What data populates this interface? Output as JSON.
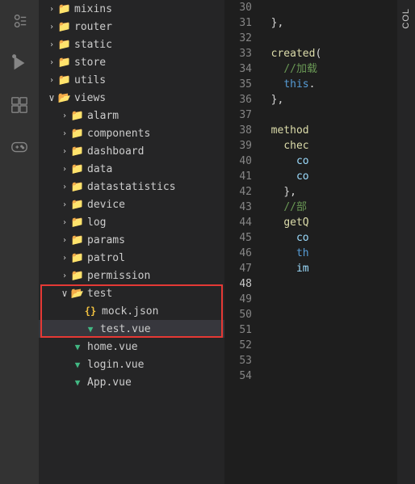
{
  "activityBar": {
    "icons": [
      {
        "name": "explorer-icon",
        "label": "Explorer"
      },
      {
        "name": "run-icon",
        "label": "Run"
      },
      {
        "name": "extensions-icon",
        "label": "Extensions"
      },
      {
        "name": "gamepad-icon",
        "label": "Gamepad"
      }
    ]
  },
  "fileTree": {
    "items": [
      {
        "id": "mixins",
        "label": "mixins",
        "type": "folder",
        "depth": 1,
        "chevron": "›",
        "expanded": false
      },
      {
        "id": "router",
        "label": "router",
        "type": "folder",
        "depth": 1,
        "chevron": "›",
        "expanded": false
      },
      {
        "id": "static",
        "label": "static",
        "type": "folder",
        "depth": 1,
        "chevron": "›",
        "expanded": false
      },
      {
        "id": "store",
        "label": "store",
        "type": "folder",
        "depth": 1,
        "chevron": "›",
        "expanded": false
      },
      {
        "id": "utils",
        "label": "utils",
        "type": "folder",
        "depth": 1,
        "chevron": "›",
        "expanded": false
      },
      {
        "id": "views",
        "label": "views",
        "type": "folder",
        "depth": 1,
        "chevron": "∨",
        "expanded": true
      },
      {
        "id": "alarm",
        "label": "alarm",
        "type": "folder",
        "depth": 2,
        "chevron": "›",
        "expanded": false
      },
      {
        "id": "components",
        "label": "components",
        "type": "folder",
        "depth": 2,
        "chevron": "›",
        "expanded": false
      },
      {
        "id": "dashboard",
        "label": "dashboard",
        "type": "folder",
        "depth": 2,
        "chevron": "›",
        "expanded": false
      },
      {
        "id": "data",
        "label": "data",
        "type": "folder",
        "depth": 2,
        "chevron": "›",
        "expanded": false
      },
      {
        "id": "datastatistics",
        "label": "datastatistics",
        "type": "folder",
        "depth": 2,
        "chevron": "›",
        "expanded": false
      },
      {
        "id": "device",
        "label": "device",
        "type": "folder",
        "depth": 2,
        "chevron": "›",
        "expanded": false
      },
      {
        "id": "log",
        "label": "log",
        "type": "folder",
        "depth": 2,
        "chevron": "›",
        "expanded": false
      },
      {
        "id": "params",
        "label": "params",
        "type": "folder",
        "depth": 2,
        "chevron": "›",
        "expanded": false
      },
      {
        "id": "patrol",
        "label": "patrol",
        "type": "folder",
        "depth": 2,
        "chevron": "›",
        "expanded": false
      },
      {
        "id": "permission",
        "label": "permission",
        "type": "folder",
        "depth": 2,
        "chevron": "›",
        "expanded": false
      },
      {
        "id": "test",
        "label": "test",
        "type": "folder",
        "depth": 2,
        "chevron": "∨",
        "expanded": true,
        "highlighted": true
      },
      {
        "id": "mock.json",
        "label": "mock.json",
        "type": "json",
        "depth": 3,
        "highlighted": true
      },
      {
        "id": "test.vue",
        "label": "test.vue",
        "type": "vue",
        "depth": 3,
        "highlighted": true,
        "selected": true
      },
      {
        "id": "home.vue",
        "label": "home.vue",
        "type": "vue",
        "depth": 2
      },
      {
        "id": "login.vue",
        "label": "login.vue",
        "type": "vue",
        "depth": 2
      },
      {
        "id": "App.vue",
        "label": "App.vue",
        "type": "vue",
        "depth": 2
      }
    ]
  },
  "editor": {
    "lines": [
      {
        "num": 30,
        "content": ""
      },
      {
        "num": 31,
        "content": "  },"
      },
      {
        "num": 32,
        "content": ""
      },
      {
        "num": 33,
        "content": "  created("
      },
      {
        "num": 34,
        "content": "    //加载"
      },
      {
        "num": 35,
        "content": "    this."
      },
      {
        "num": 36,
        "content": "  },"
      },
      {
        "num": 37,
        "content": ""
      },
      {
        "num": 38,
        "content": "  method"
      },
      {
        "num": 39,
        "content": "    chec"
      },
      {
        "num": 40,
        "content": "      co"
      },
      {
        "num": 41,
        "content": "      co"
      },
      {
        "num": 42,
        "content": "    },"
      },
      {
        "num": 43,
        "content": "    //部"
      },
      {
        "num": 44,
        "content": "    getQ"
      },
      {
        "num": 45,
        "content": "      co"
      },
      {
        "num": 46,
        "content": "      th"
      },
      {
        "num": 47,
        "content": "      im"
      },
      {
        "num": 48,
        "content": ""
      },
      {
        "num": 49,
        "content": ""
      },
      {
        "num": 50,
        "content": ""
      },
      {
        "num": 51,
        "content": ""
      },
      {
        "num": 52,
        "content": ""
      },
      {
        "num": 53,
        "content": ""
      },
      {
        "num": 54,
        "content": ""
      }
    ],
    "colIndicator": "COL"
  }
}
